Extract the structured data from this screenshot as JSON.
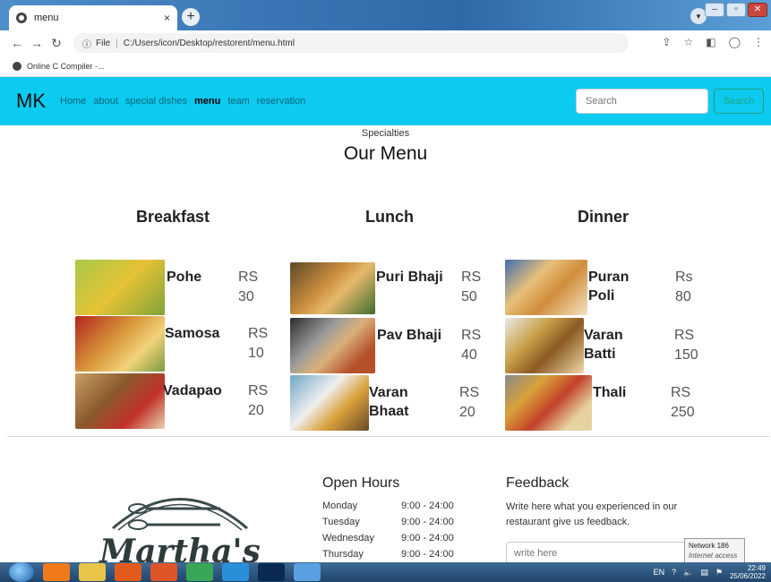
{
  "browser": {
    "tab_title": "menu",
    "tab_close": "×",
    "new_tab": "+",
    "url_prefix": "File",
    "url": "C:/Users/icon/Desktop/restorent/menu.html",
    "bookmark": "Online C Compiler -..."
  },
  "navbar": {
    "brand": "MK",
    "links": [
      "Home",
      "about",
      "special dishes",
      "menu",
      "team",
      "reservation"
    ],
    "active": "menu",
    "search_placeholder": "Search",
    "search_button": "Search"
  },
  "menu": {
    "subtitle": "Specialties",
    "title": "Our Menu",
    "columns": [
      {
        "heading": "Breakfast",
        "dishes": [
          {
            "name": "Pohe",
            "currency": "RS",
            "price": "30"
          },
          {
            "name": "Samosa",
            "currency": "RS",
            "price": "10"
          },
          {
            "name": "Vadapao",
            "currency": "RS",
            "price": "20"
          }
        ]
      },
      {
        "heading": "Lunch",
        "dishes": [
          {
            "name": "Puri Bhaji",
            "currency": "RS",
            "price": "50"
          },
          {
            "name": "Pav Bhaji",
            "currency": "RS",
            "price": "40"
          },
          {
            "name_line1": "Varan",
            "name_line2": "Bhaat",
            "currency": "RS",
            "price": "20"
          }
        ]
      },
      {
        "heading": "Dinner",
        "dishes": [
          {
            "name_line1": "Puran",
            "name_line2": "Poli",
            "currency": "Rs",
            "price": "80"
          },
          {
            "name_line1": "Varan",
            "name_line2": "Batti",
            "currency": "RS",
            "price": "150"
          },
          {
            "name": "Thali",
            "currency": "RS",
            "price": "250"
          }
        ]
      }
    ]
  },
  "footer": {
    "logo_text": "Martha's",
    "hours_title": "Open Hours",
    "hours": [
      {
        "day": "Monday",
        "time": "9:00 - 24:00"
      },
      {
        "day": "Tuesday",
        "time": "9:00 - 24:00"
      },
      {
        "day": "Wednesday",
        "time": "9:00 - 24:00"
      },
      {
        "day": "Thursday",
        "time": "9:00 - 24:00"
      }
    ],
    "feedback_title": "Feedback",
    "feedback_text": "Write here what you experienced in our restaurant give us feedback.",
    "feedback_placeholder": "write here"
  },
  "system": {
    "network_tooltip_line1": "Network 186",
    "network_tooltip_line2": "Internet access",
    "language": "EN",
    "time": "22:49",
    "date": "25/06/2022"
  },
  "colors": {
    "navbar_bg": "#0dcaf0",
    "search_button": "#1aa57a"
  }
}
